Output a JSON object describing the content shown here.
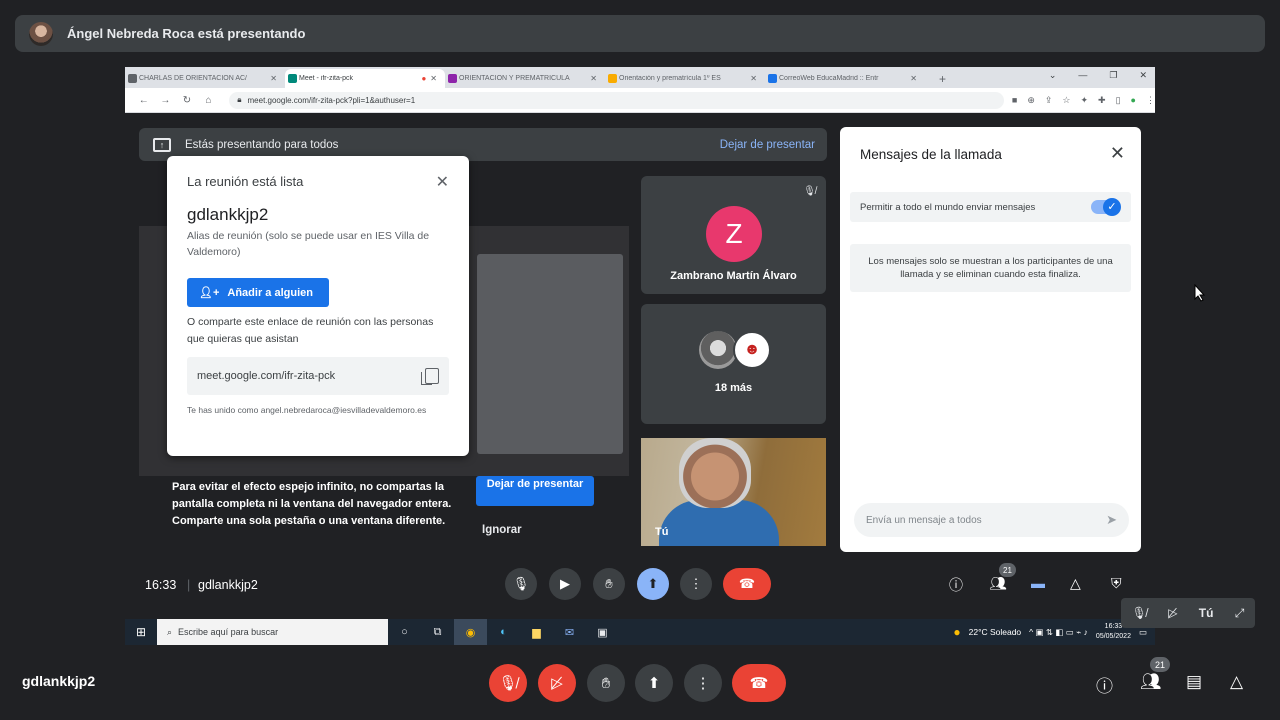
{
  "presenter": {
    "text": "Ángel Nebreda Roca está presentando"
  },
  "browser": {
    "tabs": [
      {
        "label": "CHARLAS DE ORIENTACIÓN AC/",
        "color": "#5f6368",
        "active": false
      },
      {
        "label": "Meet - ifr-zita-pck",
        "color": "#00897b",
        "active": true
      },
      {
        "label": "ORIENTACIÓN Y PREMATRÍCULA",
        "color": "#8e24aa",
        "active": false
      },
      {
        "label": "Orientación y prematrícula 1º ES",
        "color": "#f9ab00",
        "active": false
      },
      {
        "label": "CorreoWeb EducaMadrid :: Entr",
        "color": "#1a73e8",
        "active": false
      }
    ],
    "url": "meet.google.com/ifr-zita-pck?pli=1&authuser=1"
  },
  "meet": {
    "banner_text": "Estás presentando para todos",
    "stop_presenting_link": "Dejar de presentar",
    "dialog": {
      "title": "La reunión está lista",
      "code": "gdlankkjp2",
      "alias": "Alias de reunión (solo se puede usar en IES Villa de Valdemoro)",
      "add_button": "Añadir a alguien",
      "share_text": "O comparte este enlace de reunión con las personas que quieras que asistan",
      "link": "meet.google.com/ifr-zita-pck",
      "joined": "Te has unido como angel.nebredaroca@iesvilladevaldemoro.es"
    },
    "warning_text": "Para evitar el efecto espejo infinito, no compartas la pantalla completa ni la ventana del navegador entera. Comparte una sola pestaña o una ventana diferente.",
    "stop_button": "Dejar de presentar",
    "ignore_button": "Ignorar",
    "tiles": {
      "z_initial": "Z",
      "z_name": "Zambrano Martín Álvaro",
      "more": "18 más",
      "me": "Tú"
    },
    "chat": {
      "title": "Mensajes de la llamada",
      "allow_label": "Permitir a todo el mundo enviar mensajes",
      "allow_enabled": true,
      "info": "Los mensajes solo se muestran a los participantes de una llamada y se eliminan cuando esta finaliza.",
      "input_placeholder": "Envía un mensaje a todos"
    },
    "bottom": {
      "time": "16:33",
      "code": "gdlankkjp2",
      "participants_badge": "21"
    }
  },
  "taskbar": {
    "search_placeholder": "Escribe aquí para buscar",
    "weather": "22°C  Soleado",
    "time": "16:33",
    "date": "05/05/2022"
  },
  "self_view": {
    "label": "Tú"
  },
  "outer_bottom": {
    "code": "gdlankkjp2",
    "participants_badge": "21"
  },
  "colors": {
    "accent": "#1a73e8",
    "danger": "#ea4335",
    "dark_bg": "#202124",
    "tile_bg": "#3c4043"
  }
}
